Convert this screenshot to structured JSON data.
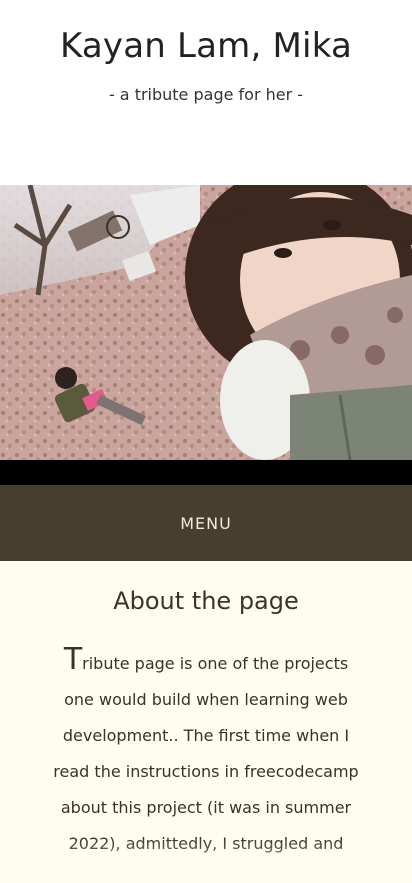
{
  "header": {
    "title": "Kayan Lam, Mika",
    "subtitle": "- a tribute page for her -"
  },
  "hero": {
    "image_icon": "photo-icon"
  },
  "menu": {
    "label": "MENU"
  },
  "about": {
    "title": "About the page",
    "drop_cap": "T",
    "text": "ribute page is one of the projects one would build when learning web development.. The first time when I read the instructions in freecodecamp about this project (it was in summer 2022), admittedly, I struggled and"
  },
  "colors": {
    "menu_bg": "#483e2f",
    "about_bg": "#fffdf0",
    "menu_text": "#f3ead7"
  }
}
